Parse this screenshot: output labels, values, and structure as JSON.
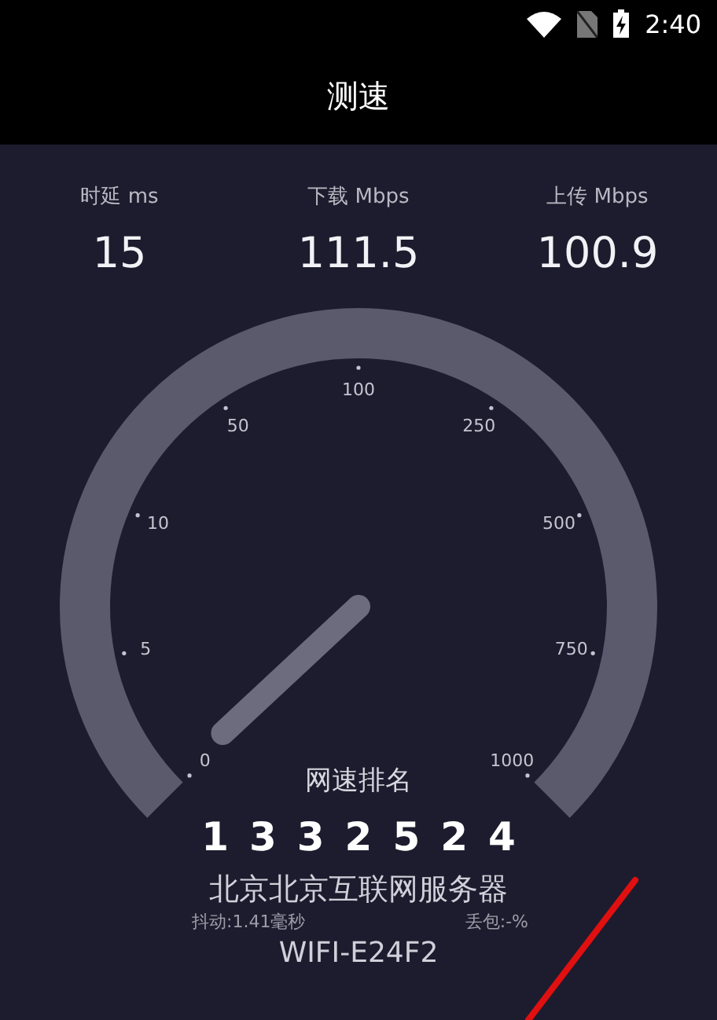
{
  "status_bar": {
    "time": "2:40"
  },
  "title": "测速",
  "metrics": [
    {
      "label": "时延 ms",
      "value": "15"
    },
    {
      "label": "下载 Mbps",
      "value": "111.5"
    },
    {
      "label": "上传 Mbps",
      "value": "100.9"
    }
  ],
  "gauge": {
    "ticks": [
      "0",
      "5",
      "10",
      "50",
      "100",
      "250",
      "500",
      "750",
      "1000"
    ]
  },
  "ranking": {
    "title": "网速排名",
    "digits": [
      "1",
      "3",
      "3",
      "2",
      "5",
      "2",
      "4"
    ]
  },
  "server": "北京北京互联网服务器",
  "jitter": "抖动:1.41毫秒",
  "packet_loss": "丢包:-%",
  "network": "WIFI-E24F2"
}
